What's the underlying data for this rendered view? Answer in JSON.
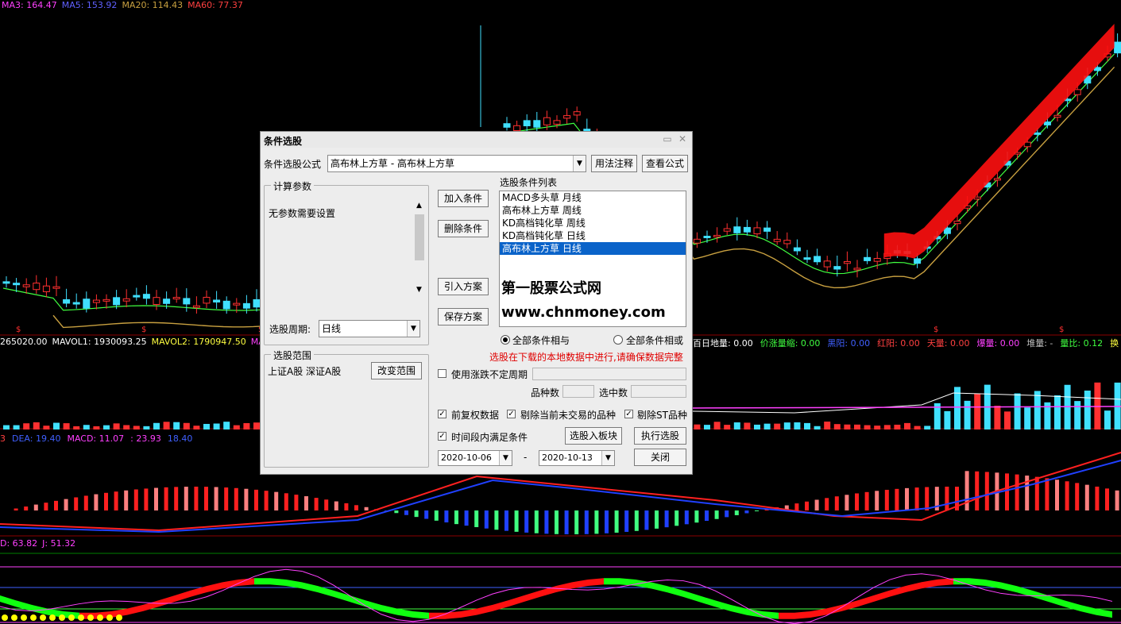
{
  "indicators": {
    "ma_line": [
      {
        "label": "MA3: 164.47",
        "color": "#ff40ff"
      },
      {
        "label": "MA5: 153.92",
        "color": "#6060ff"
      },
      {
        "label": "MA20: 114.43",
        "color": "#c8a040"
      },
      {
        "label": "MA60: 77.37",
        "color": "#ff4040"
      }
    ],
    "vol_line": [
      {
        "label": "265020.00",
        "color": "#ffffff"
      },
      {
        "label": "MAVOL1: 1930093.25",
        "color": "#ffffff"
      },
      {
        "label": "MAVOL2: 1790947.50",
        "color": "#ffff40"
      },
      {
        "label": "MAV",
        "color": "#ff40ff"
      }
    ],
    "vol_right": [
      {
        "label": "百日地量: 0.00",
        "color": "#ffffff"
      },
      {
        "label": "价涨量缩: 0.00",
        "color": "#40ff40"
      },
      {
        "label": "黑阳: 0.00",
        "color": "#4060ff"
      },
      {
        "label": "红阳: 0.00",
        "color": "#ff4040"
      },
      {
        "label": "天量: 0.00",
        "color": "#ff4040"
      },
      {
        "label": "爆量: 0.00",
        "color": "#ff40ff"
      },
      {
        "label": "堆量: -",
        "color": "#c0c0c0"
      },
      {
        "label": "量比: 0.12",
        "color": "#40ff40"
      },
      {
        "label": "换",
        "color": "#ffff40"
      }
    ],
    "macd_line": [
      {
        "label": "3",
        "color": "#ff4040"
      },
      {
        "label": "DEA: 19.40",
        "color": "#4060ff"
      },
      {
        "label": "MACD: 11.07",
        "color": "#ff40ff"
      },
      {
        "label": ": 23.93",
        "color": "#ff40ff"
      },
      {
        "label": "18.40",
        "color": "#4060ff"
      }
    ],
    "kdj_line": [
      {
        "label": "D: 63.82",
        "color": "#ff40ff"
      },
      {
        "label": "J: 51.32",
        "color": "#ff40ff"
      }
    ],
    "marker_glyph": "$"
  },
  "dialog": {
    "title": "条件选股",
    "formula_label": "条件选股公式",
    "formula_value": "高布林上方草 - 高布林上方草",
    "usage_button": "用法注释",
    "view_button": "查看公式",
    "params_group": "计算参数",
    "params_text": "无参数需要设置",
    "period_label": "选股周期:",
    "period_value": "日线",
    "add_button": "加入条件",
    "delete_button": "删除条件",
    "import_button": "引入方案",
    "save_button": "保存方案",
    "cond_list_label": "选股条件列表",
    "conditions": [
      {
        "text": "MACD多头草  月线",
        "selected": false
      },
      {
        "text": "高布林上方草  周线",
        "selected": false
      },
      {
        "text": "KD高档钝化草  周线",
        "selected": false
      },
      {
        "text": "KD高档钝化草  日线",
        "selected": false
      },
      {
        "text": "高布林上方草  日线",
        "selected": true
      }
    ],
    "watermark_cn": "第一股票公式网",
    "watermark_url": "www.chnmoney.com",
    "radio_and": "全部条件相与",
    "radio_or": "全部条件相或",
    "warning": "选股在下载的本地数据中进行,请确保数据完整",
    "range_group": "选股范围",
    "range_text": "上证A股  深证A股",
    "change_range": "改变范围",
    "use_period": "使用涨跌不定周期",
    "count_label": "品种数",
    "selected_label": "选中数",
    "prev_restore": "前复权数据",
    "exclude_untraded": "剔除当前未交易的品种",
    "exclude_st": "剔除ST品种",
    "time_segment": "时间段内满足条件",
    "to_block": "选股入板块",
    "execute": "执行选股",
    "close": "关闭",
    "date_from": "2020-10-06",
    "date_to": "2020-10-13",
    "dash": "-",
    "colors": {
      "warning": "#e00000",
      "selection": "#0a63c9"
    }
  }
}
